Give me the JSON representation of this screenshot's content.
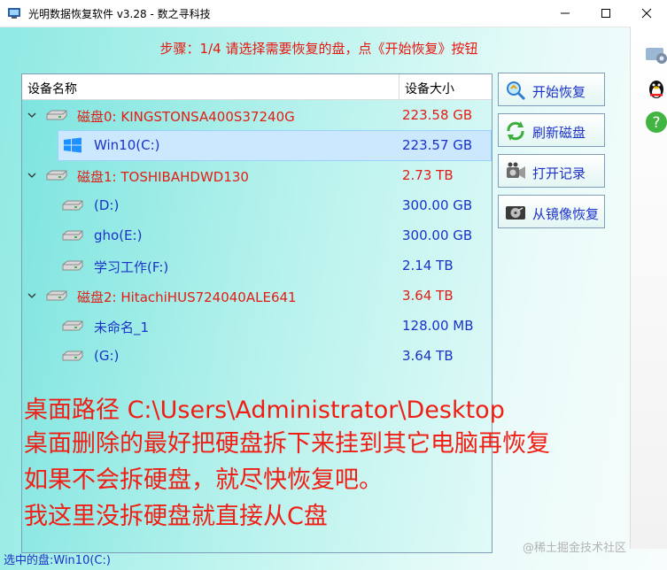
{
  "window": {
    "title": "光明数据恢复软件 v3.28 - 数之寻科技",
    "minimize_icon": "minimize-icon",
    "maximize_icon": "maximize-icon",
    "close_icon": "close-icon"
  },
  "step_text": "步骤：1/4 请选择需要恢复的盘，点《开始恢复》按钮",
  "tree": {
    "columns": {
      "name": "设备名称",
      "size": "设备大小"
    },
    "rows": [
      {
        "type": "disk",
        "name": "磁盘0: KINGSTONSA400S37240G",
        "size": "223.58 GB"
      },
      {
        "type": "partition",
        "name": "Win10(C:)",
        "size": "223.57 GB",
        "selected": true
      },
      {
        "type": "disk",
        "name": "磁盘1: TOSHIBAHDWD130",
        "size": "2.73 TB"
      },
      {
        "type": "partition",
        "name": "(D:)",
        "size": "300.00 GB"
      },
      {
        "type": "partition",
        "name": "gho(E:)",
        "size": "300.00 GB"
      },
      {
        "type": "partition",
        "name": "学习工作(F:)",
        "size": "2.14 TB"
      },
      {
        "type": "disk",
        "name": "磁盘2: HitachiHUS724040ALE641",
        "size": "3.64 TB"
      },
      {
        "type": "partition",
        "name": "未命名_1",
        "size": "128.00 MB"
      },
      {
        "type": "partition",
        "name": "(G:)",
        "size": "3.64 TB"
      }
    ]
  },
  "notes": [
    "桌面路径 C:\\Users\\Administrator\\Desktop",
    "桌面删除的最好把硬盘拆下来挂到其它电脑再恢复",
    "如果不会拆硬盘，就尽快恢复吧。",
    "我这里没拆硬盘就直接从C盘"
  ],
  "buttons": {
    "start": "开始恢复",
    "refresh": "刷新磁盘",
    "open_record": "打开记录",
    "from_image": "从镜像恢复"
  },
  "status": "选中的盘:Win10(C:)",
  "watermark": "@稀土掘金技术社区",
  "colors": {
    "disk_text": "#e21d14",
    "partition_text": "#1a32c8",
    "note_text": "#f01e14",
    "selection": "#cce8ff"
  }
}
